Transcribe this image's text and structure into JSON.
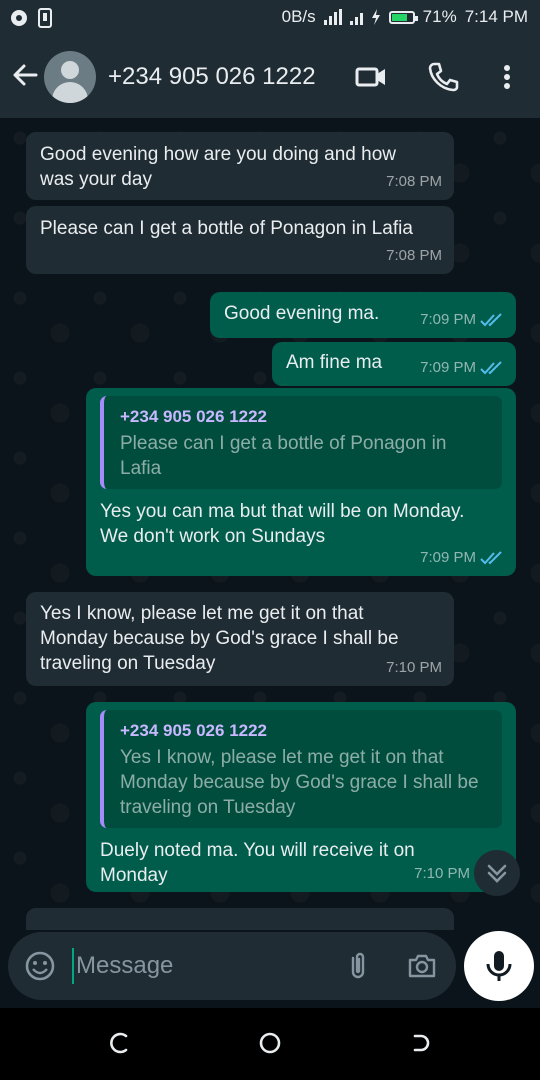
{
  "status": {
    "net_speed": "0B/s",
    "battery": "71%",
    "time": "7:14 PM"
  },
  "header": {
    "title": "+234 905 026 1222",
    "icons": [
      "back-arrow-icon",
      "avatar",
      "video-call-icon",
      "voice-call-icon",
      "more-vert-icon"
    ]
  },
  "messages": [
    {
      "dir": "in",
      "text": "Good evening how are you doing and how was your day",
      "time": "7:08 PM"
    },
    {
      "dir": "in",
      "text": "Please can I get a bottle of Ponagon in Lafia",
      "time": "7:08 PM"
    },
    {
      "dir": "out",
      "text": "Good evening ma.",
      "time": "7:09 PM"
    },
    {
      "dir": "out",
      "text": "Am fine ma",
      "time": "7:09 PM"
    },
    {
      "dir": "out",
      "quote_name": "+234 905 026 1222",
      "quote_text": "Please can I get a bottle of Ponagon in Lafia",
      "text": "Yes you can ma but that will be on Monday. We don't work on Sundays",
      "time": "7:09 PM"
    },
    {
      "dir": "in",
      "text": "Yes I know, please let me get it on that Monday because by God's grace I shall be traveling on Tuesday",
      "time": "7:10 PM"
    },
    {
      "dir": "out",
      "quote_name": "+234 905 026 1222",
      "quote_text": "Yes I know, please let me get it on that Monday because by God's grace I shall be traveling on Tuesday",
      "text": "Duely noted ma. You will receive it on Monday",
      "time": "7:10 PM"
    }
  ],
  "input": {
    "placeholder": "Message"
  },
  "colors": {
    "incoming": "#202c33",
    "outgoing": "#005c4b",
    "accent": "#00a884",
    "read_tick": "#53bdeb"
  }
}
